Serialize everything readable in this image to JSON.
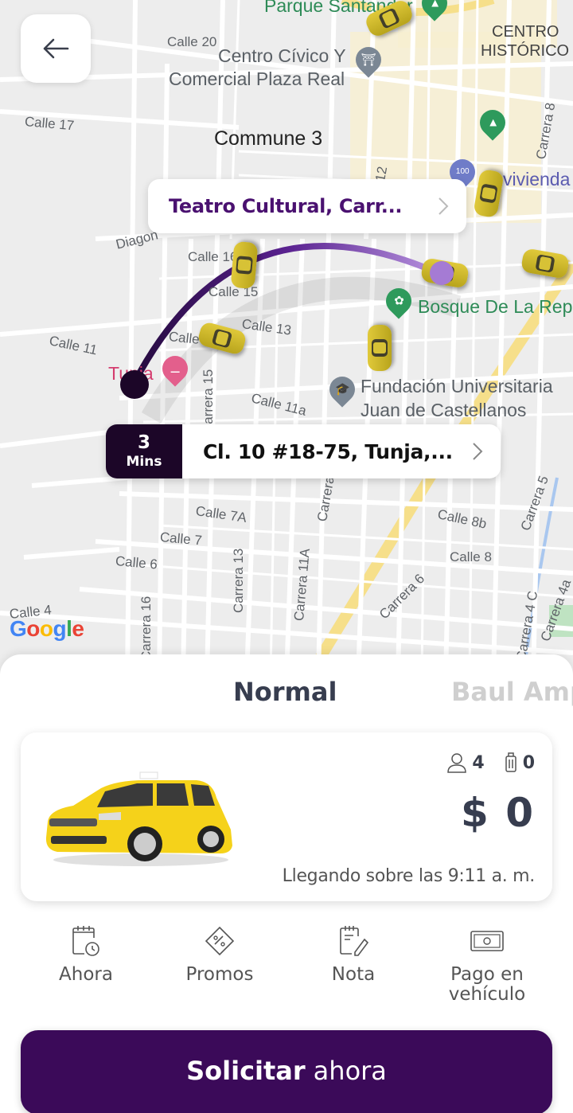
{
  "navigation": {
    "back_icon": "arrow-left-icon"
  },
  "map": {
    "labels": {
      "parque_santander": "Parque Santander",
      "calle_20": "Calle 20",
      "centro_civico_line1": "Centro Cívico Y",
      "centro_civico_line2": "Comercial Plaza Real",
      "centro_historico_line1": "CENTRO",
      "centro_historico_line2": "HISTÓRICO",
      "calle_17": "Calle 17",
      "commune_3": "Commune 3",
      "vivienda": "vivienda",
      "carrera_8": "Carrera 8",
      "carrera_12": "12",
      "diagonal": "Diagon",
      "calle_16": "Calle 16",
      "calle_15": "Calle 15",
      "calle_13": "Calle 13",
      "calle_12": "Calle",
      "calle_11": "Calle 11",
      "calle_11a": "Calle 11a",
      "tunja": "Tunja",
      "bosque": "Bosque De La República",
      "fundacion_line1": "Fundación Universitaria",
      "fundacion_line2": "Juan de Castellanos",
      "carrera_15": "Carrera 15",
      "calle_7a": "Calle 7A",
      "calle_7": "Calle 7",
      "calle_6": "Calle 6",
      "calle_4": "Calle 4",
      "carrera_16": "Carrera 16",
      "carrera_13": "Carrera 13",
      "carrera_11a": "Carrera 11A",
      "carrera_11": "Carrera",
      "carrera_6": "Carrera 6",
      "calle_8b": "Calle 8b",
      "calle_8": "Calle 8",
      "carrera_5": "Carrera 5",
      "carrera_4c": "Carrera 4 C",
      "carrera_4a": "Carrera 4a",
      "google": "Google"
    },
    "destination": {
      "label": "Teatro Cultural, Carr...",
      "chevron_icon": "chevron-right-icon"
    },
    "origin": {
      "eta_value": "3",
      "eta_unit": "Mins",
      "label": "Cl. 10 #18-75, Tunja,...",
      "chevron_icon": "chevron-right-icon"
    },
    "route_color": "#3b0a59",
    "route_end_color": "#a57bd4"
  },
  "sheet": {
    "tabs": [
      {
        "label": "Normal",
        "active": true
      },
      {
        "label": "Baul Amplio",
        "active": false
      }
    ],
    "vehicle": {
      "image": "yellow-taxi-car",
      "passengers": "4",
      "luggage": "0",
      "price": "$ 0",
      "arrival": "Llegando sobre las 9:11 a. m."
    },
    "options": [
      {
        "label": "Ahora",
        "icon": "calendar-clock-icon"
      },
      {
        "label": "Promos",
        "icon": "coupon-tag-icon"
      },
      {
        "label": "Nota",
        "icon": "note-pencil-icon"
      },
      {
        "label": "Pago en vehículo",
        "icon": "cash-icon"
      }
    ],
    "cta": {
      "bold": "Solicitar",
      "light": "ahora"
    },
    "accent_color": "#3b0a59"
  }
}
